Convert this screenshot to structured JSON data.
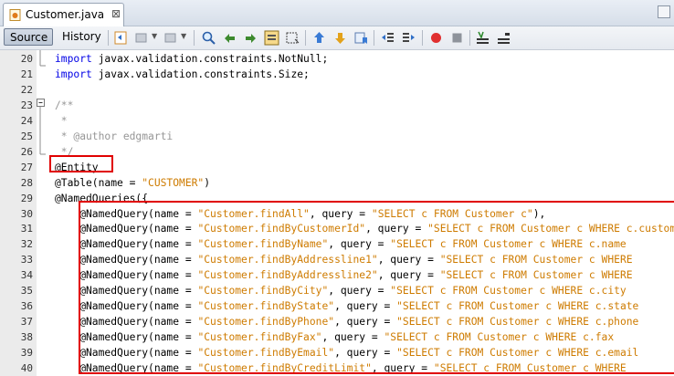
{
  "tab": {
    "title": "Customer.java",
    "close": "⊠"
  },
  "toolbar": {
    "source_label": "Source",
    "history_label": "History"
  },
  "editor": {
    "lines": [
      {
        "num": "20",
        "parts": [
          {
            "t": "import",
            "c": "kw"
          },
          {
            "t": " javax.validation.constraints.NotNull;",
            "c": ""
          }
        ]
      },
      {
        "num": "21",
        "parts": [
          {
            "t": "import",
            "c": "kw"
          },
          {
            "t": " javax.validation.constraints.Size;",
            "c": ""
          }
        ]
      },
      {
        "num": "22",
        "parts": []
      },
      {
        "num": "23",
        "parts": [
          {
            "t": "/**",
            "c": "cm"
          }
        ]
      },
      {
        "num": "24",
        "parts": [
          {
            "t": " *",
            "c": "cm"
          }
        ]
      },
      {
        "num": "25",
        "parts": [
          {
            "t": " * @author edgmarti",
            "c": "cm"
          }
        ]
      },
      {
        "num": "26",
        "parts": [
          {
            "t": " */",
            "c": "cm"
          }
        ]
      },
      {
        "num": "27",
        "parts": [
          {
            "t": "@Entity",
            "c": ""
          }
        ]
      },
      {
        "num": "28",
        "parts": [
          {
            "t": "@Table(name = ",
            "c": ""
          },
          {
            "t": "\"CUSTOMER\"",
            "c": "str"
          },
          {
            "t": ")",
            "c": ""
          }
        ]
      },
      {
        "num": "29",
        "parts": [
          {
            "t": "@NamedQueries({",
            "c": ""
          }
        ]
      },
      {
        "num": "30",
        "parts": [
          {
            "t": "    @NamedQuery(name = ",
            "c": ""
          },
          {
            "t": "\"Customer.findAll\"",
            "c": "str"
          },
          {
            "t": ", query = ",
            "c": ""
          },
          {
            "t": "\"SELECT c FROM Customer c\"",
            "c": "str"
          },
          {
            "t": "),",
            "c": ""
          }
        ]
      },
      {
        "num": "31",
        "parts": [
          {
            "t": "    @NamedQuery(name = ",
            "c": ""
          },
          {
            "t": "\"Customer.findByCustomerId\"",
            "c": "str"
          },
          {
            "t": ", query = ",
            "c": ""
          },
          {
            "t": "\"SELECT c FROM Customer c WHERE c.customerId",
            "c": "str"
          }
        ]
      },
      {
        "num": "32",
        "parts": [
          {
            "t": "    @NamedQuery(name = ",
            "c": ""
          },
          {
            "t": "\"Customer.findByName\"",
            "c": "str"
          },
          {
            "t": ", query = ",
            "c": ""
          },
          {
            "t": "\"SELECT c FROM Customer c WHERE c.name",
            "c": "str"
          }
        ]
      },
      {
        "num": "33",
        "parts": [
          {
            "t": "    @NamedQuery(name = ",
            "c": ""
          },
          {
            "t": "\"Customer.findByAddressline1\"",
            "c": "str"
          },
          {
            "t": ", query = ",
            "c": ""
          },
          {
            "t": "\"SELECT c FROM Customer c WHERE",
            "c": "str"
          }
        ]
      },
      {
        "num": "34",
        "parts": [
          {
            "t": "    @NamedQuery(name = ",
            "c": ""
          },
          {
            "t": "\"Customer.findByAddressline2\"",
            "c": "str"
          },
          {
            "t": ", query = ",
            "c": ""
          },
          {
            "t": "\"SELECT c FROM Customer c WHERE",
            "c": "str"
          }
        ]
      },
      {
        "num": "35",
        "parts": [
          {
            "t": "    @NamedQuery(name = ",
            "c": ""
          },
          {
            "t": "\"Customer.findByCity\"",
            "c": "str"
          },
          {
            "t": ", query = ",
            "c": ""
          },
          {
            "t": "\"SELECT c FROM Customer c WHERE c.city",
            "c": "str"
          }
        ]
      },
      {
        "num": "36",
        "parts": [
          {
            "t": "    @NamedQuery(name = ",
            "c": ""
          },
          {
            "t": "\"Customer.findByState\"",
            "c": "str"
          },
          {
            "t": ", query = ",
            "c": ""
          },
          {
            "t": "\"SELECT c FROM Customer c WHERE c.state",
            "c": "str"
          }
        ]
      },
      {
        "num": "37",
        "parts": [
          {
            "t": "    @NamedQuery(name = ",
            "c": ""
          },
          {
            "t": "\"Customer.findByPhone\"",
            "c": "str"
          },
          {
            "t": ", query = ",
            "c": ""
          },
          {
            "t": "\"SELECT c FROM Customer c WHERE c.phone",
            "c": "str"
          }
        ]
      },
      {
        "num": "38",
        "parts": [
          {
            "t": "    @NamedQuery(name = ",
            "c": ""
          },
          {
            "t": "\"Customer.findByFax\"",
            "c": "str"
          },
          {
            "t": ", query = ",
            "c": ""
          },
          {
            "t": "\"SELECT c FROM Customer c WHERE c.fax",
            "c": "str"
          }
        ]
      },
      {
        "num": "39",
        "parts": [
          {
            "t": "    @NamedQuery(name = ",
            "c": ""
          },
          {
            "t": "\"Customer.findByEmail\"",
            "c": "str"
          },
          {
            "t": ", query = ",
            "c": ""
          },
          {
            "t": "\"SELECT c FROM Customer c WHERE c.email",
            "c": "str"
          }
        ]
      },
      {
        "num": "40",
        "parts": [
          {
            "t": "    @NamedQuery(name = ",
            "c": ""
          },
          {
            "t": "\"Customer.findByCreditLimit\"",
            "c": "str"
          },
          {
            "t": ", query = ",
            "c": ""
          },
          {
            "t": "\"SELECT c FROM Customer c WHERE",
            "c": "str"
          }
        ]
      }
    ]
  },
  "colors": {
    "keyword": "#0000e6",
    "string": "#ce7b00",
    "comment": "#969696",
    "highlight": "#e00000"
  },
  "icons": [
    "java-file-icon",
    "close-icon",
    "restore-window-icon",
    "last-edit-icon",
    "back-icon",
    "forward-icon",
    "find-selection-icon",
    "find-previous-icon",
    "find-next-icon",
    "toggle-highlight-icon",
    "toggle-rectangular-selection-icon",
    "previous-bookmark-icon",
    "next-bookmark-icon",
    "toggle-bookmark-icon",
    "shift-left-icon",
    "shift-right-icon",
    "start-macro-icon",
    "stop-macro-icon",
    "comment-icon",
    "uncomment-icon"
  ]
}
